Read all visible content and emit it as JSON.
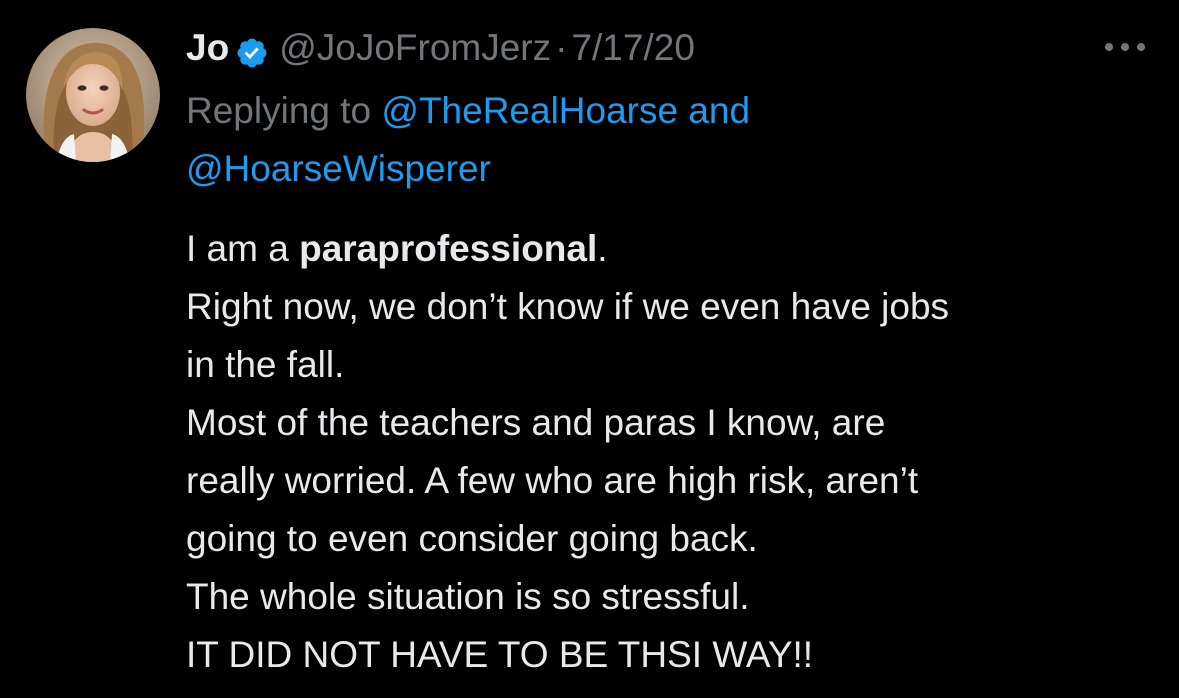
{
  "author": {
    "display_name": "Jo",
    "handle": "@JoJoFromJerz",
    "separator": "·",
    "date": "7/17/20",
    "verified_icon": "verified-badge-icon",
    "avatar_icon": "avatar"
  },
  "more_icon": "more-horizontal-icon",
  "reply_context": {
    "prefix": "Replying to",
    "mention_1": "@TheRealHoarse",
    "conjunction": "and",
    "mention_2": "@HoarseWisperer"
  },
  "body": {
    "line1_before": "I am a ",
    "line1_bold": "paraprofessional",
    "line1_after": ".",
    "line2": "Right now, we don’t know if we even have jobs",
    "line3": "in the fall.",
    "line4": "Most of the teachers and paras I know, are",
    "line5": "really worried. A few who are high risk, aren’t",
    "line6": "going to even consider going back.",
    "line7": "The whole situation is so stressful.",
    "line8": "IT DID NOT HAVE TO BE THSI WAY!!"
  },
  "colors": {
    "background": "#000000",
    "primary_text": "#e7e9ea",
    "secondary_text": "#71767b",
    "accent": "#1d9bf0"
  }
}
